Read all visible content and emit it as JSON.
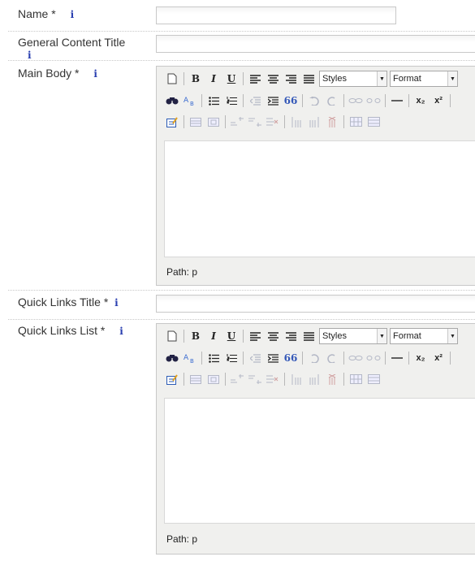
{
  "fields": {
    "name": {
      "label": "Name *",
      "info": "i",
      "value": ""
    },
    "general_content_title": {
      "label": "General Content Title",
      "info": "i",
      "value": ""
    },
    "main_body": {
      "label": "Main Body *",
      "info": "i"
    },
    "quick_links_title": {
      "label": "Quick Links Title *",
      "info": "i",
      "value": ""
    },
    "quick_links_list": {
      "label": "Quick Links List *",
      "info": "i"
    }
  },
  "editor": {
    "bold": "B",
    "italic": "I",
    "underline": "U",
    "styles_select": "Styles",
    "format_select": "Format",
    "blockquote": "66",
    "path_label": "Path: p",
    "subscript_label": "x₂",
    "superscript_label": "x²"
  },
  "icons": [
    "new-document-icon",
    "bold-icon",
    "italic-icon",
    "underline-icon",
    "align-left-icon",
    "align-center-icon",
    "align-right-icon",
    "align-justify-icon",
    "find-icon",
    "replace-icon",
    "bullet-list-icon",
    "numbered-list-icon",
    "outdent-icon",
    "indent-icon",
    "blockquote-icon",
    "undo-icon",
    "redo-icon",
    "link-icon",
    "unlink-icon",
    "horizontal-rule-icon",
    "subscript-icon",
    "superscript-icon",
    "cleanup-code-icon",
    "table-icon",
    "table-row-icon",
    "insert-row-before-icon",
    "insert-row-after-icon",
    "delete-row-icon",
    "insert-col-before-icon",
    "insert-col-after-icon",
    "delete-col-icon",
    "split-cells-icon",
    "merge-cells-icon"
  ],
  "colors": {
    "info": "#2a3fb0",
    "toolbar_bg": "#f0f0ee",
    "border": "#c8c8c8"
  }
}
